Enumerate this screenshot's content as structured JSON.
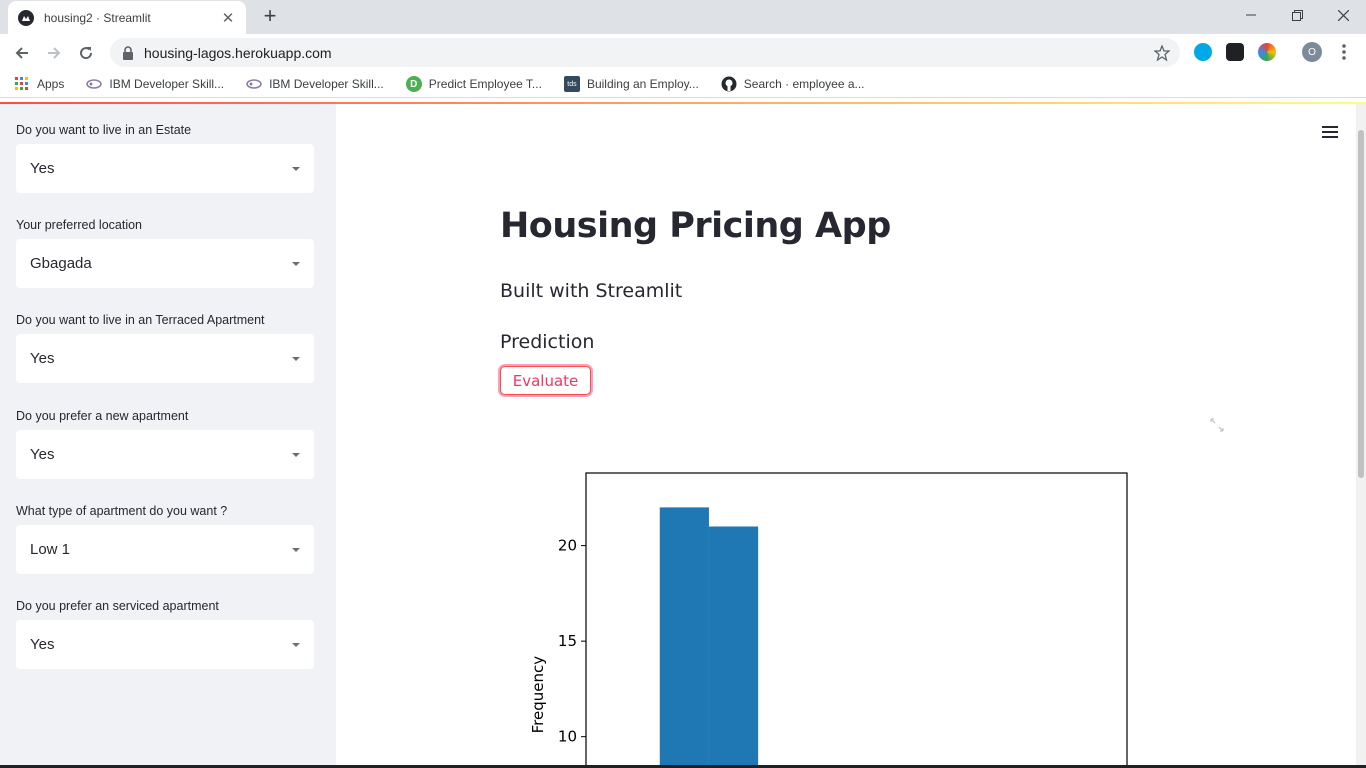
{
  "browser": {
    "tab_title": "housing2 · Streamlit",
    "url": "housing-lagos.herokuapp.com",
    "profile_initial": "O",
    "bookmarks": [
      {
        "label": "Apps",
        "icon": "apps-grid-icon"
      },
      {
        "label": "IBM Developer Skill...",
        "icon": "ibm-skills-icon"
      },
      {
        "label": "IBM Developer Skill...",
        "icon": "ibm-skills-icon"
      },
      {
        "label": "Predict Employee T...",
        "icon": "d-badge-icon"
      },
      {
        "label": "Building an Employ...",
        "icon": "tds-icon"
      },
      {
        "label": "Search · employee a...",
        "icon": "github-icon"
      }
    ]
  },
  "sidebar": {
    "fields": [
      {
        "label": "Do you want to live in an Estate",
        "value": "Yes"
      },
      {
        "label": "Your preferred location",
        "value": "Gbagada"
      },
      {
        "label": "Do you want to live in an Terraced Apartment",
        "value": "Yes"
      },
      {
        "label": "Do you prefer a new apartment",
        "value": "Yes"
      },
      {
        "label": "What type of apartment do you want ?",
        "value": "Low 1"
      },
      {
        "label": "Do you prefer an serviced apartment",
        "value": "Yes"
      }
    ]
  },
  "main": {
    "title": "Housing Pricing App",
    "subtitle": "Built with Streamlit",
    "section_title": "Prediction",
    "evaluate_label": "Evaluate"
  },
  "colors": {
    "accent": "#f63366",
    "bar": "#1f77b4",
    "sidebar_bg": "#f0f2f6"
  },
  "chart_data": {
    "type": "bar",
    "title": "",
    "xlabel": "",
    "ylabel": "Frequency",
    "yticks": [
      10,
      15,
      20
    ],
    "visible_ylim": [
      8.1,
      23.8
    ],
    "bars": [
      {
        "x_start": 0,
        "x_end": 1,
        "value": 22
      },
      {
        "x_start": 1,
        "x_end": 2,
        "value": 21
      }
    ],
    "xlim": [
      -1.5,
      9.5
    ]
  }
}
